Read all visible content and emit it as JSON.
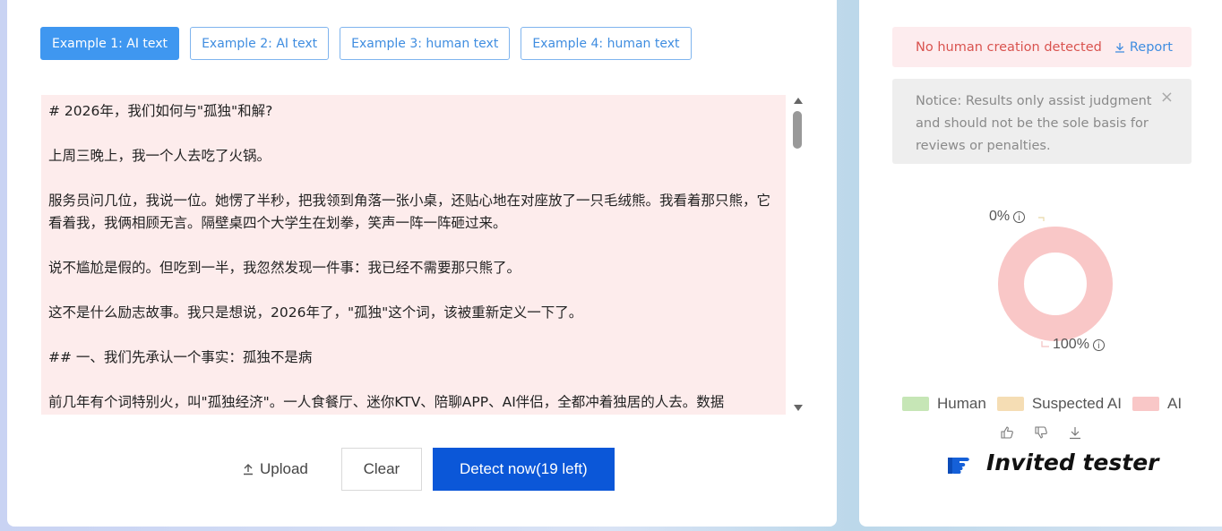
{
  "tabs": [
    {
      "label": "Example 1: AI text",
      "active": true
    },
    {
      "label": "Example 2: AI text",
      "active": false
    },
    {
      "label": "Example 3: human text",
      "active": false
    },
    {
      "label": "Example 4: human text",
      "active": false
    }
  ],
  "text_input": {
    "paragraphs": [
      "# 2026年，我们如何与\"孤独\"和解?",
      "上周三晚上，我一个人去吃了火锅。",
      "服务员问几位，我说一位。她愣了半秒，把我领到角落一张小桌，还贴心地在对座放了一只毛绒熊。我看着那只熊，它看着我，我俩相顾无言。隔壁桌四个大学生在划拳，笑声一阵一阵砸过来。",
      "说不尴尬是假的。但吃到一半，我忽然发现一件事：我已经不需要那只熊了。",
      "这不是什么励志故事。我只是想说，2026年了，\"孤独\"这个词，该被重新定义一下了。",
      "## 一、我们先承认一个事实：孤独不是病",
      "前几年有个词特别火，叫\"孤独经济\"。一人食餐厅、迷你KTV、陪聊APP、AI伴侣，全都冲着独居的人去。数据"
    ]
  },
  "actions": {
    "upload_label": "Upload",
    "clear_label": "Clear",
    "detect_label": "Detect now(19 left)"
  },
  "result": {
    "alert_text": "No human creation detected",
    "report_label": "Report",
    "notice_text": "Notice: Results only assist judgment and should not be the sole basis for reviews or penalties.",
    "close_symbol": "×"
  },
  "chart_data": {
    "type": "pie",
    "style": "donut",
    "labels": [
      "Human",
      "Suspected AI",
      "AI"
    ],
    "values": [
      0,
      0,
      100
    ],
    "colors": [
      "#c6e6b6",
      "#f5ddb4",
      "#f9c7c7"
    ],
    "label_texts": {
      "top": "0%",
      "bottom": "100%"
    },
    "legend_position": "bottom"
  },
  "legend": [
    {
      "label": "Human",
      "color": "#c6e6b6"
    },
    {
      "label": "Suspected AI",
      "color": "#f5ddb4"
    },
    {
      "label": "AI",
      "color": "#f9c7c7"
    }
  ],
  "feedback_icons": [
    "thumbs-up-icon",
    "thumbs-down-icon",
    "download-icon"
  ],
  "tester": {
    "label": "Invited tester"
  },
  "colors": {
    "primary": "#0b57d8",
    "tab_active": "#3f97f0",
    "alert_text": "#d9534f",
    "text_area_bg": "#fdecec"
  }
}
